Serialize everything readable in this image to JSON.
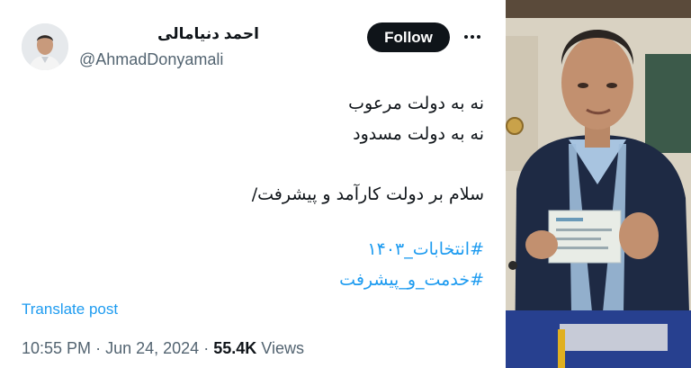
{
  "author": {
    "display_name": "احمد دنیامالی",
    "handle": "@AhmadDonyamali",
    "avatar_icon": "person-avatar"
  },
  "actions": {
    "follow_label": "Follow",
    "more_icon": "more-horizontal-icon"
  },
  "tweet": {
    "lines": [
      "نه به دولت مرعوب",
      "نه به دولت مسدود",
      "سلام بر دولت کارآمد و پیشرفت/"
    ],
    "hashtags": [
      "#انتخابات_۱۴۰۳",
      "#خدمت_و_پیشرفت"
    ],
    "translate_label": "Translate post"
  },
  "meta": {
    "time": "10:55 PM",
    "separator": "·",
    "date": "Jun 24, 2024",
    "views_count": "55.4K",
    "views_label": "Views"
  },
  "colors": {
    "link": "#1d9bf0",
    "text": "#0f1419",
    "muted": "#536471"
  }
}
